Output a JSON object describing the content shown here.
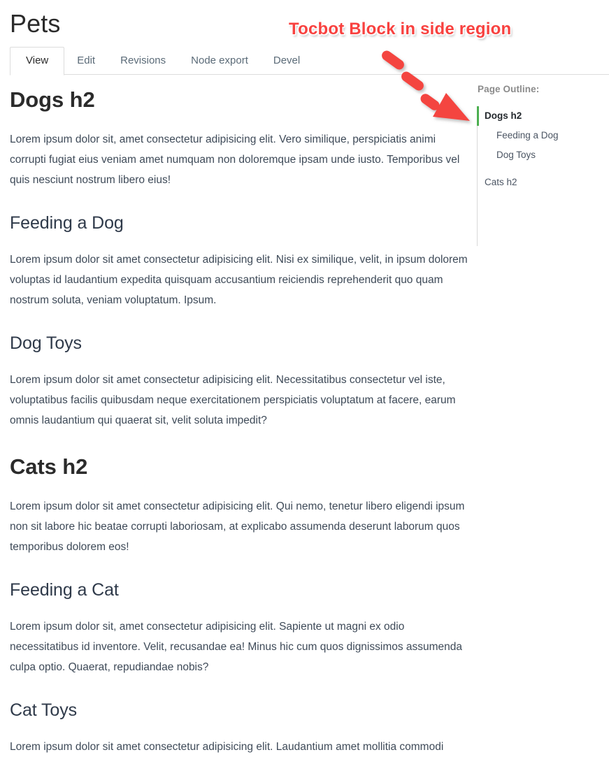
{
  "page": {
    "title": "Pets"
  },
  "tabs": [
    {
      "label": "View",
      "active": true
    },
    {
      "label": "Edit",
      "active": false
    },
    {
      "label": "Revisions",
      "active": false
    },
    {
      "label": "Node export",
      "active": false
    },
    {
      "label": "Devel",
      "active": false
    }
  ],
  "annotation": {
    "text": "Tocbot Block in side region",
    "color": "#f8413f",
    "arrow_icon": "dashed-arrow-down-right-icon"
  },
  "sidebar": {
    "heading": "Page Outline:",
    "active_marker_color": "#4caf50",
    "rail_color": "#d8d8d8",
    "items": [
      {
        "label": "Dogs h2",
        "level": 2,
        "active": true
      },
      {
        "label": "Feeding a Dog",
        "level": 3,
        "active": false
      },
      {
        "label": "Dog Toys",
        "level": 3,
        "active": false
      },
      {
        "label": "Cats h2",
        "level": 2,
        "active": false
      }
    ]
  },
  "content": {
    "sections": [
      {
        "heading": "Dogs h2",
        "level": 2,
        "body": "Lorem ipsum dolor sit, amet consectetur adipisicing elit. Vero similique, perspiciatis animi corrupti fugiat eius veniam amet numquam non doloremque ipsam unde iusto. Temporibus vel quis nesciunt nostrum libero eius!"
      },
      {
        "heading": "Feeding a Dog",
        "level": 3,
        "body": "Lorem ipsum dolor sit amet consectetur adipisicing elit. Nisi ex similique, velit, in ipsum dolorem voluptas id laudantium expedita quisquam accusantium reiciendis reprehenderit quo quam nostrum soluta, veniam voluptatum. Ipsum."
      },
      {
        "heading": "Dog Toys",
        "level": 3,
        "body": "Lorem ipsum dolor sit amet consectetur adipisicing elit. Necessitatibus consectetur vel iste, voluptatibus facilis quibusdam neque exercitationem perspiciatis voluptatum at facere, earum omnis laudantium qui quaerat sit, velit soluta impedit?"
      },
      {
        "heading": "Cats h2",
        "level": 2,
        "body": "Lorem ipsum dolor sit amet consectetur adipisicing elit. Qui nemo, tenetur libero eligendi ipsum non sit labore hic beatae corrupti laboriosam, at explicabo assumenda deserunt laborum quos temporibus dolorem eos!"
      },
      {
        "heading": "Feeding a Cat",
        "level": 3,
        "body": "Lorem ipsum dolor sit, amet consectetur adipisicing elit. Sapiente ut magni ex odio necessitatibus id inventore. Velit, recusandae ea! Minus hic cum quos dignissimos assumenda culpa optio. Quaerat, repudiandae nobis?"
      },
      {
        "heading": "Cat Toys",
        "level": 3,
        "body": "Lorem ipsum dolor sit amet consectetur adipisicing elit. Laudantium amet mollitia commodi"
      }
    ]
  }
}
